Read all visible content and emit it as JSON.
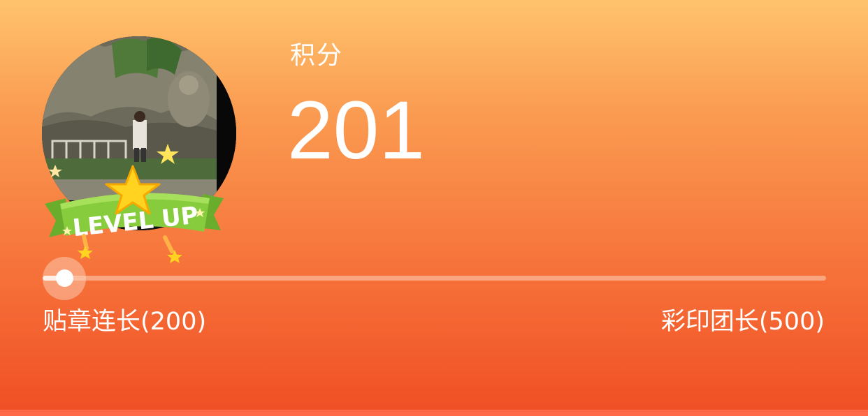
{
  "points": {
    "label": "积分",
    "value": "201"
  },
  "avatar": {
    "badge_text": "LEVEL UP"
  },
  "progress": {
    "current": 201,
    "start_value": 200,
    "end_value": 500,
    "fraction": 0.003,
    "start_label": "贴章连长(200)",
    "end_label": "彩印团长(500)"
  },
  "colors": {
    "background_top": "#ffc36d",
    "background_bottom": "#f04e24",
    "badge_green": "#7cc43a",
    "star_yellow": "#ffd31f"
  }
}
